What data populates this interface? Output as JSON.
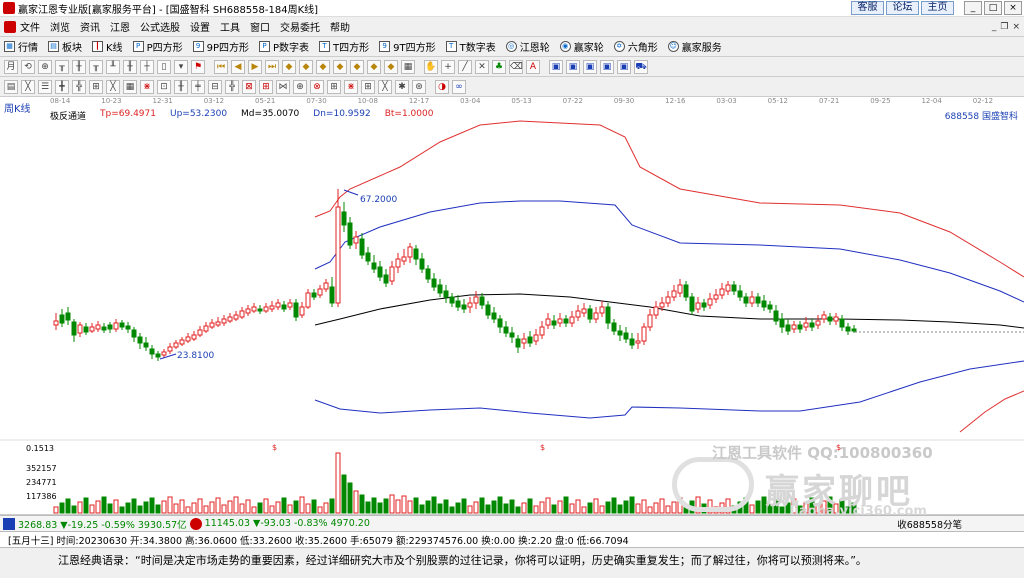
{
  "window": {
    "title": "赢家江恩专业版[赢家服务平台] - [国盛智科  SH688558-184周K线]",
    "links": [
      "客服",
      "论坛",
      "主页"
    ]
  },
  "menu": [
    "文件",
    "浏览",
    "资讯",
    "江恩",
    "公式选股",
    "设置",
    "工具",
    "窗口",
    "交易委托",
    "帮助"
  ],
  "toolbar1": [
    {
      "icon": "chart-icon",
      "label": "行情"
    },
    {
      "icon": "block-icon",
      "label": "板块"
    },
    {
      "icon": "kline-icon",
      "label": "K线"
    },
    {
      "icon": "p-square-icon",
      "label": "P四方形"
    },
    {
      "icon": "9p-square-icon",
      "label": "9P四方形"
    },
    {
      "icon": "p-table-icon",
      "label": "P数字表"
    },
    {
      "icon": "t-square-icon",
      "label": "T四方形"
    },
    {
      "icon": "9t-square-icon",
      "label": "9T四方形"
    },
    {
      "icon": "t-table-icon",
      "label": "T数字表"
    },
    {
      "icon": "gann-wheel-icon",
      "label": "江恩轮"
    },
    {
      "icon": "winner-wheel-icon",
      "label": "赢家轮"
    },
    {
      "icon": "hexagon-icon",
      "label": "六角形"
    },
    {
      "icon": "service-icon",
      "label": "赢家服务"
    }
  ],
  "chart": {
    "period_label": "周K线",
    "dates": [
      "08-14",
      "10-23",
      "12-31",
      "03-12",
      "05-21",
      "07-30",
      "10-08",
      "12-17",
      "03-04",
      "05-13",
      "07-22",
      "09-30",
      "12-16",
      "03-03",
      "05-12",
      "07-21",
      "09-25",
      "12-04",
      "02-12"
    ],
    "indicator": {
      "name": "极反通道",
      "tp": "Tp=69.4971",
      "up": "Up=53.2300",
      "md": "Md=35.0070",
      "dn": "Dn=10.9592",
      "bt": "Bt=1.0000"
    },
    "stock": "688558  国盛智科",
    "max_label": "67.2000",
    "min_label": "23.8100",
    "volume_labels": [
      "0.1513",
      "352157",
      "234771",
      "117386"
    ],
    "volume_marker": "$",
    "colors": {
      "up": "#e02020",
      "down": "#008800",
      "upper_band": "#e03030",
      "mid_band": "#2030c0",
      "mid_line": "#000000"
    }
  },
  "watermark": {
    "line1": "江恩工具软件  QQ:100800360",
    "line2": "赢家聊吧",
    "line3": "liaoba.vici360.com"
  },
  "indexbar": {
    "sh": "3268.83 ▼-19.25 -0.59% 3930.57亿",
    "sz": "11145.03 ▼-93.03 -0.83% 4970.20",
    "right": "收688558分笔"
  },
  "status": "[五月十三] 时间:20230630 开:34.3800 高:36.0600 低:33.2600 收:35.2600 手:65079 额:229374576.00 换:0.00 换:2.20 盘:0 低:66.7094",
  "quote": "江恩经典语录：“时间是决定市场走势的重要因素，经过详细研究大市及个别股票的过往记录，你将可以证明，历史确实重复发生；而了解过往，你将可以预测将来。”。"
}
